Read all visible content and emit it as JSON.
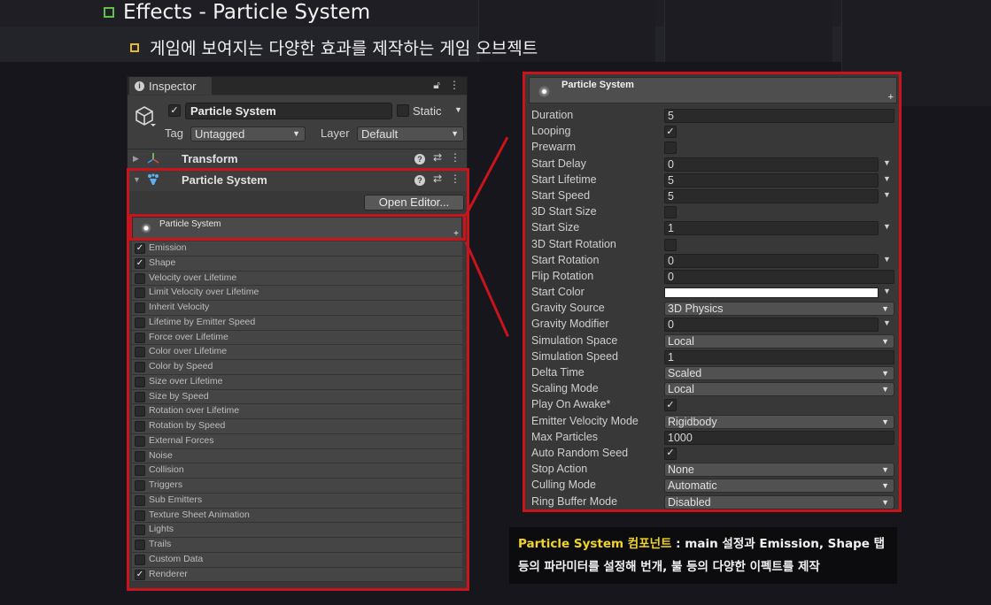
{
  "slide": {
    "title": "Effects - Particle System",
    "subtitle": "게임에 보여지는 다양한 효과를 제작하는 게임 오브젝트"
  },
  "colors": {
    "highlight": "#c8141a",
    "accent_text": "#f1d42a",
    "title_bullet": "#5fc24a",
    "sub_bullet": "#e9b82a"
  },
  "inspector": {
    "tab_label": "Inspector",
    "object_name": "Particle System",
    "static_label": "Static",
    "tag_label": "Tag",
    "tag_value": "Untagged",
    "layer_label": "Layer",
    "layer_value": "Default",
    "transform_label": "Transform",
    "component_label": "Particle System",
    "open_editor_label": "Open Editor...",
    "module_header_label": "Particle System",
    "modules": [
      {
        "label": "Emission",
        "checked": true
      },
      {
        "label": "Shape",
        "checked": true
      },
      {
        "label": "Velocity over Lifetime",
        "checked": false
      },
      {
        "label": "Limit Velocity over Lifetime",
        "checked": false
      },
      {
        "label": "Inherit Velocity",
        "checked": false
      },
      {
        "label": "Lifetime by Emitter Speed",
        "checked": false
      },
      {
        "label": "Force over Lifetime",
        "checked": false
      },
      {
        "label": "Color over Lifetime",
        "checked": false
      },
      {
        "label": "Color by Speed",
        "checked": false
      },
      {
        "label": "Size over Lifetime",
        "checked": false
      },
      {
        "label": "Size by Speed",
        "checked": false
      },
      {
        "label": "Rotation over Lifetime",
        "checked": false
      },
      {
        "label": "Rotation by Speed",
        "checked": false
      },
      {
        "label": "External Forces",
        "checked": false
      },
      {
        "label": "Noise",
        "checked": false
      },
      {
        "label": "Collision",
        "checked": false
      },
      {
        "label": "Triggers",
        "checked": false
      },
      {
        "label": "Sub Emitters",
        "checked": false
      },
      {
        "label": "Texture Sheet Animation",
        "checked": false
      },
      {
        "label": "Lights",
        "checked": false
      },
      {
        "label": "Trails",
        "checked": false
      },
      {
        "label": "Custom Data",
        "checked": false
      },
      {
        "label": "Renderer",
        "checked": true
      }
    ]
  },
  "main_module": {
    "header": "Particle System",
    "properties": [
      {
        "name": "Duration",
        "kind": "field",
        "value": "5"
      },
      {
        "name": "Looping",
        "kind": "check",
        "checked": true
      },
      {
        "name": "Prewarm",
        "kind": "check",
        "checked": false
      },
      {
        "name": "Start Delay",
        "kind": "curve",
        "value": "0"
      },
      {
        "name": "Start Lifetime",
        "kind": "curve",
        "value": "5"
      },
      {
        "name": "Start Speed",
        "kind": "curve",
        "value": "5"
      },
      {
        "name": "3D Start Size",
        "kind": "check",
        "checked": false
      },
      {
        "name": "Start Size",
        "kind": "curve",
        "value": "1"
      },
      {
        "name": "3D Start Rotation",
        "kind": "check",
        "checked": false
      },
      {
        "name": "Start Rotation",
        "kind": "curve",
        "value": "0"
      },
      {
        "name": "Flip Rotation",
        "kind": "field",
        "value": "0"
      },
      {
        "name": "Start Color",
        "kind": "color",
        "value": "#ffffff"
      },
      {
        "name": "Gravity Source",
        "kind": "dropdown",
        "value": "3D Physics"
      },
      {
        "name": "Gravity Modifier",
        "kind": "curve",
        "value": "0"
      },
      {
        "name": "Simulation Space",
        "kind": "dropdown",
        "value": "Local"
      },
      {
        "name": "Simulation Speed",
        "kind": "field",
        "value": "1"
      },
      {
        "name": "Delta Time",
        "kind": "dropdown",
        "value": "Scaled"
      },
      {
        "name": "Scaling Mode",
        "kind": "dropdown",
        "value": "Local"
      },
      {
        "name": "Play On Awake*",
        "kind": "check",
        "checked": true
      },
      {
        "name": "Emitter Velocity Mode",
        "kind": "dropdown",
        "value": "Rigidbody"
      },
      {
        "name": "Max Particles",
        "kind": "field",
        "value": "1000"
      },
      {
        "name": "Auto Random Seed",
        "kind": "check",
        "checked": true
      },
      {
        "name": "Stop Action",
        "kind": "dropdown",
        "value": "None"
      },
      {
        "name": "Culling Mode",
        "kind": "dropdown",
        "value": "Automatic"
      },
      {
        "name": "Ring Buffer Mode",
        "kind": "dropdown",
        "value": "Disabled"
      }
    ]
  },
  "caption": {
    "highlight": "Particle System 컴포넌트",
    "line1_rest": " : main 설정과 Emission, Shape 탭",
    "line2": "등의 파라미터를 설정해 번개, 불 등의 다양한 이펙트를 제작"
  }
}
